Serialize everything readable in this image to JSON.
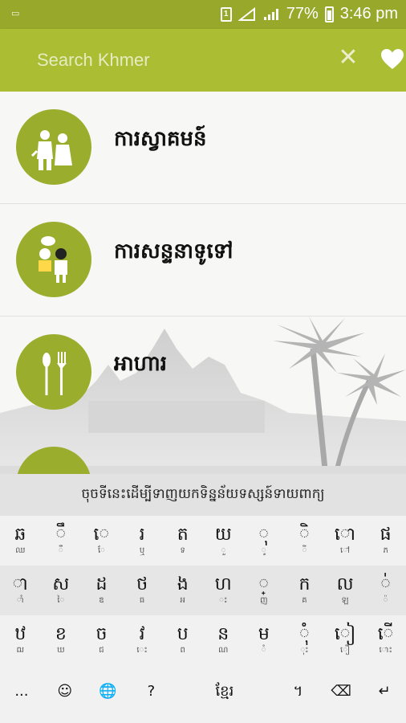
{
  "status_bar": {
    "battery": "77%",
    "time": "3:46 pm",
    "sim": "1"
  },
  "search": {
    "placeholder": "Search Khmer"
  },
  "list": [
    {
      "label": "ការស្វាគមន៍",
      "icon": "greeting-people-icon"
    },
    {
      "label": "ការសន្ទនាទូទៅ",
      "icon": "conversation-people-icon"
    },
    {
      "label": "អាហារ",
      "icon": "spoon-fork-icon"
    }
  ],
  "keyboard": {
    "suggestion": "ចុចទីនេះដើម្បីទាញយកទិន្នន័យទស្សន៍ទាយពាក្យ",
    "row1": [
      {
        "main": "ឆ",
        "sub": "ឈ"
      },
      {
        "main": "ឹ",
        "sub": "ឺ"
      },
      {
        "main": "េ",
        "sub": "ែ"
      },
      {
        "main": "រ",
        "sub": "ឬ"
      },
      {
        "main": "ត",
        "sub": "ទ"
      },
      {
        "main": "យ",
        "sub": "ួ"
      },
      {
        "main": "ុ",
        "sub": "ូ"
      },
      {
        "main": "ិ",
        "sub": "ី"
      },
      {
        "main": "ោ",
        "sub": "ៅ"
      },
      {
        "main": "ផ",
        "sub": "ភ"
      }
    ],
    "row2": [
      {
        "main": "ា",
        "sub": "ាំ"
      },
      {
        "main": "ស",
        "sub": "ៃ"
      },
      {
        "main": "ដ",
        "sub": "ឌ"
      },
      {
        "main": "ថ",
        "sub": "ធ"
      },
      {
        "main": "ង",
        "sub": "អ"
      },
      {
        "main": "ហ",
        "sub": "ះ"
      },
      {
        "main": "្",
        "sub": "ញ"
      },
      {
        "main": "ក",
        "sub": "គ"
      },
      {
        "main": "ល",
        "sub": "ឡ"
      },
      {
        "main": "់",
        "sub": "៉"
      }
    ],
    "row3": [
      {
        "main": "ឋ",
        "sub": "ឍ"
      },
      {
        "main": "ខ",
        "sub": "ឃ"
      },
      {
        "main": "ច",
        "sub": "ជ"
      },
      {
        "main": "វ",
        "sub": "េះ"
      },
      {
        "main": "ប",
        "sub": "ព"
      },
      {
        "main": "ន",
        "sub": "ណ"
      },
      {
        "main": "ម",
        "sub": "ំ"
      },
      {
        "main": "ុំ",
        "sub": "ុះ"
      },
      {
        "main": "ៀ",
        "sub": "ឿ"
      },
      {
        "main": "ើ",
        "sub": "ោះ"
      }
    ],
    "bottom": {
      "more": "...",
      "emoji": "☺",
      "globe": "🌐",
      "question": "?",
      "lang": "ខ្មែរ",
      "khmer_period": "។",
      "backspace": "⌫",
      "enter": "↵"
    }
  }
}
